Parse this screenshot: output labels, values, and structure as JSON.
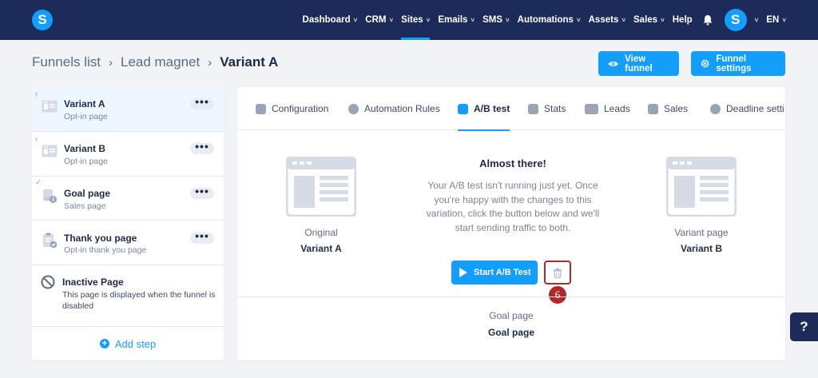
{
  "nav": {
    "logo": "S",
    "items": [
      {
        "label": "Dashboard",
        "chevron": true
      },
      {
        "label": "CRM",
        "chevron": true
      },
      {
        "label": "Sites",
        "chevron": true,
        "active": true
      },
      {
        "label": "Emails",
        "chevron": true
      },
      {
        "label": "SMS",
        "chevron": true
      },
      {
        "label": "Automations",
        "chevron": true
      },
      {
        "label": "Assets",
        "chevron": true
      },
      {
        "label": "Sales",
        "chevron": true
      },
      {
        "label": "Help",
        "chevron": false
      }
    ],
    "avatar": "S",
    "language": "EN",
    "chevron_glyph": "˅"
  },
  "breadcrumb": {
    "items": [
      "Funnels list",
      "Lead magnet"
    ],
    "current": "Variant A",
    "separator": "›"
  },
  "header_buttons": {
    "view_funnel": "View funnel",
    "funnel_settings": "Funnel settings"
  },
  "steps": [
    {
      "title": "Variant A",
      "subtitle": "Opt-in page",
      "icon": "page-icon",
      "menu": "•••",
      "selected": true
    },
    {
      "title": "Variant B",
      "subtitle": "Opt-in page",
      "icon": "page-icon",
      "menu": "•••"
    },
    {
      "title": "Goal page",
      "subtitle": "Sales page",
      "icon": "coins-icon",
      "menu": "•••",
      "mark": "✓"
    },
    {
      "title": "Thank you page",
      "subtitle": "Opt-in thank you page",
      "icon": "clipboard-check-icon",
      "menu": "•••"
    },
    {
      "title": "Inactive Page",
      "subtitle": "This page is displayed when the funnel is disabled",
      "icon": "ban-icon"
    }
  ],
  "add_step": "Add step",
  "tabs": [
    {
      "label": "Configuration",
      "icon": "sliders-icon"
    },
    {
      "label": "Automation Rules",
      "icon": "bolt-icon"
    },
    {
      "label": "A/B test",
      "icon": "split-icon",
      "active": true
    },
    {
      "label": "Stats",
      "icon": "chart-icon"
    },
    {
      "label": "Leads",
      "icon": "users-icon"
    },
    {
      "label": "Sales",
      "icon": "dollar-icon"
    },
    {
      "label": "Deadline setti",
      "icon": "clock-icon"
    }
  ],
  "ab": {
    "original": {
      "label": "Original",
      "name": "Variant A"
    },
    "variant": {
      "label": "Variant page",
      "name": "Variant B"
    },
    "heading": "Almost there!",
    "text": "Your A/B test isn't running just yet. Once you're happy with the changes to this variation, click the button below and we'll start sending traffic to both.",
    "start_button": "Start A/B Test",
    "annotation": "6",
    "goal": {
      "label": "Goal page",
      "name": "Goal page"
    }
  },
  "help_button": "?",
  "colors": {
    "nav": "#1c2b5a",
    "accent": "#149efc",
    "annotation": "#b3262a"
  }
}
